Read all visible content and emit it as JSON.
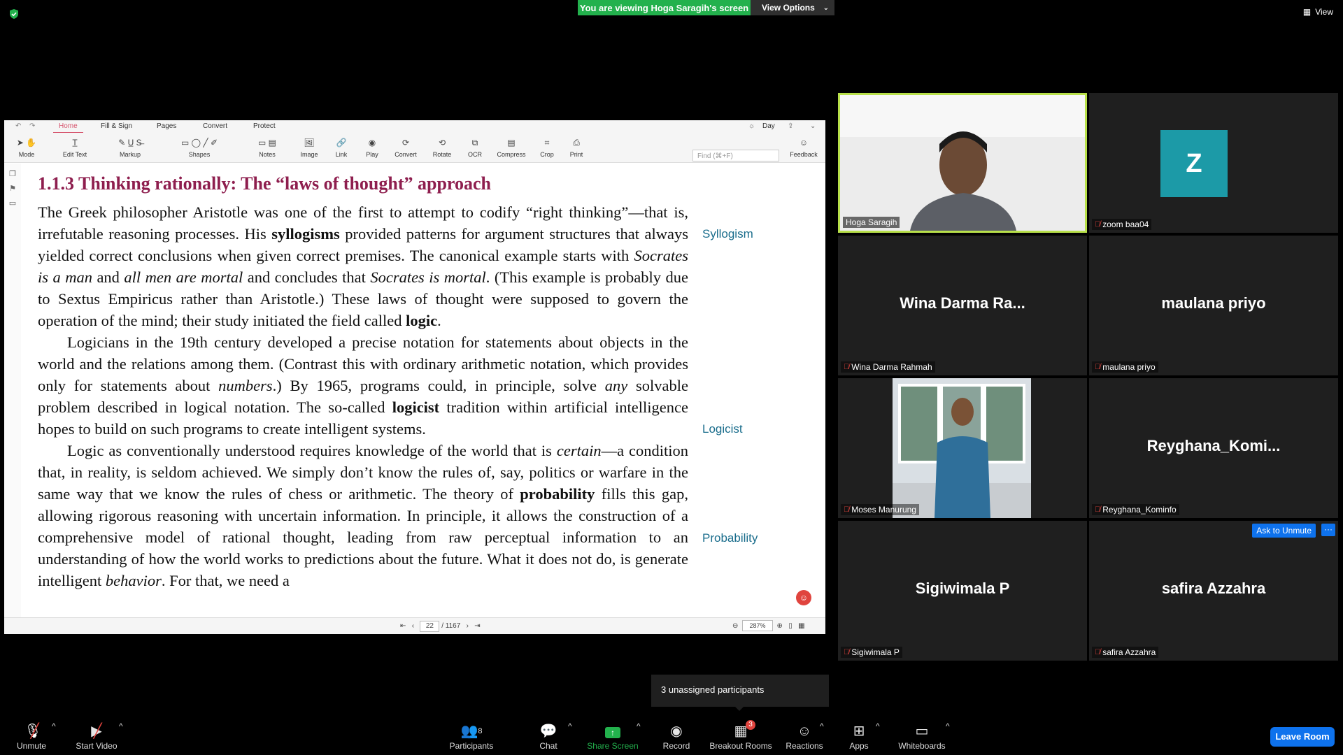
{
  "top": {
    "banner": "You are viewing Hoga Saragih's screen",
    "view_options": "View Options",
    "view": "View"
  },
  "pdf": {
    "tabs": [
      "Home",
      "Fill & Sign",
      "Pages",
      "Convert",
      "Protect"
    ],
    "day_mode": "Day",
    "tools": [
      "Mode",
      "Edit Text",
      "Markup",
      "Shapes",
      "Notes",
      "Image",
      "Link",
      "Play",
      "Convert",
      "Rotate",
      "OCR",
      "Compress",
      "Crop",
      "Print"
    ],
    "find_placeholder": "Find (⌘+F)",
    "feedback": "Feedback",
    "section_title": "1.1.3  Thinking rationally: The “laws of thought” approach",
    "margin_notes": [
      "Syllogism",
      "Logicist",
      "Probability"
    ],
    "page_current": "22",
    "page_total": "/ 1167",
    "zoom": "287%"
  },
  "participants_tiles": [
    {
      "name": "Hoga Saragih"
    },
    {
      "name": "zoom baa04",
      "avatar_letter": "Z"
    },
    {
      "name": "Wina Darma Rahmah",
      "display": "Wina Darma Ra..."
    },
    {
      "name": "maulana priyo",
      "display": "maulana priyo"
    },
    {
      "name": "Moses Manurung"
    },
    {
      "name": "Reyghana_Kominfo",
      "display": "Reyghana_Komi..."
    },
    {
      "name": "Sigiwimala P",
      "display": "Sigiwimala P"
    },
    {
      "name": "safira Azzahra",
      "display": "safira Azzahra"
    }
  ],
  "ask_to_unmute": "Ask to Unmute",
  "more": "···",
  "tooltip": "3 unassigned participants",
  "toolbar": {
    "unmute": "Unmute",
    "start_video": "Start Video",
    "participants": "Participants",
    "participants_count": "8",
    "chat": "Chat",
    "share_screen": "Share Screen",
    "record": "Record",
    "breakout_rooms": "Breakout Rooms",
    "breakout_badge": "3",
    "reactions": "Reactions",
    "apps": "Apps",
    "whiteboards": "Whiteboards",
    "leave": "Leave Room"
  },
  "colors": {
    "banner_green": "#23b14d",
    "active_speaker_border": "#b8e04a",
    "zoom_blue": "#0e72ed",
    "avatar_teal": "#1c9aa7",
    "heading_maroon": "#8e1e4e",
    "margin_note_blue": "#1a6d8c"
  }
}
